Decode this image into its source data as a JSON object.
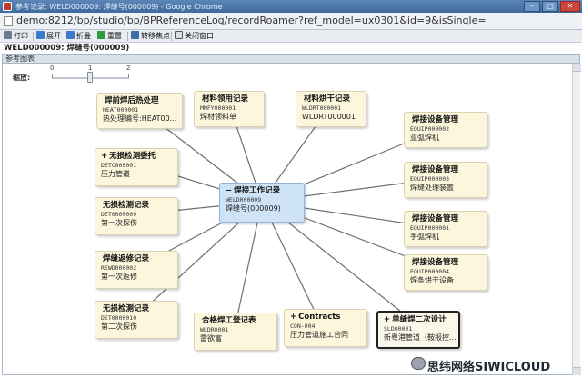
{
  "window": {
    "title": "参考记录: WELD000009: 焊缝号(000009) - Google Chrome",
    "min_label": "–",
    "max_label": "□",
    "close_label": "✕"
  },
  "address": {
    "url": "demo:8212/bp/studio/bp/BPReferenceLog/recordRoamer?ref_model=ux0301&id=9&isSingle="
  },
  "toolbar": {
    "print": "打印",
    "expand": "展开",
    "collapse": "折叠",
    "reset": "重置",
    "move_focus": "转移焦点",
    "close_window": "关闭窗口"
  },
  "record_header": "WELD000009: 焊缝号(000009)",
  "panel_title": "参考图表",
  "zoom": {
    "label": "缩放:",
    "ticks": [
      "0",
      "1",
      "2"
    ],
    "value": 1
  },
  "nodes": {
    "center": {
      "plus": "−",
      "title": "焊接工作记录",
      "code": "WELD000009",
      "desc": "焊缝号(000009)"
    },
    "n1": {
      "plus": "",
      "title": "焊前焊后热处理",
      "code": "HEAT000001",
      "desc": "热处理编号:HEAT00..."
    },
    "n2": {
      "plus": "",
      "title": "材料领用记录",
      "code": "MMFY000001",
      "desc": "焊材领料单"
    },
    "n3": {
      "plus": "",
      "title": "材料烘干记录",
      "code": "WLDRT000001",
      "desc": "WLDRT000001"
    },
    "n4": {
      "plus": "",
      "title": "焊接设备管理",
      "code": "EQUIP000002",
      "desc": "亚弧焊机"
    },
    "n5": {
      "plus": "",
      "title": "焊接设备管理",
      "code": "EQUIP000003",
      "desc": "焊缝处理装置"
    },
    "n6": {
      "plus": "",
      "title": "焊接设备管理",
      "code": "EQUIP000001",
      "desc": "手弧焊机"
    },
    "n7": {
      "plus": "",
      "title": "焊接设备管理",
      "code": "EQUIP000004",
      "desc": "焊条烘干设备"
    },
    "n8": {
      "plus": "+",
      "title": "单缝焊二次设计",
      "code": "SLD00001",
      "desc": "新粤港管道（鞍报控..."
    },
    "n9": {
      "plus": "+",
      "title": "Contracts",
      "code": "CON-004",
      "desc": "压力管道施工合同"
    },
    "n10": {
      "plus": "",
      "title": "合格焊工登记表",
      "code": "WLDR0001",
      "desc": "雷欲富"
    },
    "n11": {
      "plus": "",
      "title": "无损检测记录",
      "code": "DET0000010",
      "desc": "第二次探伤"
    },
    "n12": {
      "plus": "",
      "title": "焊缝返修记录",
      "code": "REWD000002",
      "desc": "第一次返修"
    },
    "n13": {
      "plus": "",
      "title": "无损检测记录",
      "code": "DET0000009",
      "desc": "第一次探伤"
    },
    "n14": {
      "plus": "+",
      "title": "无损检测委托",
      "code": "DETC000001",
      "desc": "压力管道"
    }
  },
  "watermark": "思纬网络SIWICLOUD",
  "colors": {
    "node_fill": "#fbf6dc",
    "center_fill": "#cfe3f7",
    "titlebar": "#4a76a8"
  }
}
